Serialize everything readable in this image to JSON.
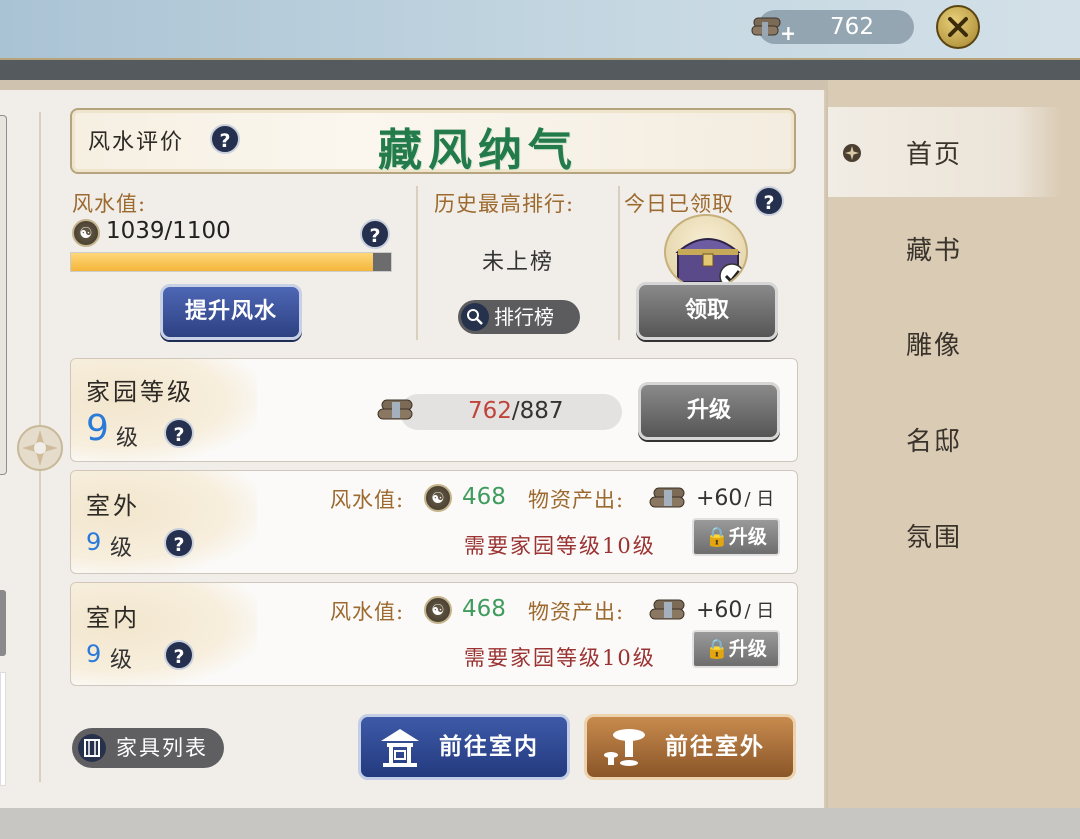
{
  "topbar": {
    "resource_value": "762"
  },
  "sidebar": {
    "items": [
      {
        "label": "首页",
        "active": true
      },
      {
        "label": "藏书",
        "active": false
      },
      {
        "label": "雕像",
        "active": false
      },
      {
        "label": "名邸",
        "active": false
      },
      {
        "label": "氛围",
        "active": false
      }
    ]
  },
  "rating": {
    "label": "风水评价",
    "title": "藏风纳气",
    "help": "?"
  },
  "fengshui": {
    "label": "风水值:",
    "value": "1039/1100",
    "progress": 0.945,
    "help": "?",
    "upgrade_button": "提升风水"
  },
  "ranking": {
    "label": "历史最高排行:",
    "value": "未上榜",
    "button": "排行榜"
  },
  "daily": {
    "label": "今日已领取",
    "help": "?",
    "button": "领取"
  },
  "home_level": {
    "title": "家园等级",
    "level_num": "9",
    "level_unit": "级",
    "help": "?",
    "progress_current": "762",
    "progress_sep": "/",
    "progress_max": "887",
    "upgrade_button": "升级"
  },
  "rooms": [
    {
      "title": "室外",
      "level_num": "9",
      "level_unit": "级",
      "help": "?",
      "fs_label": "风水值:",
      "fs_value": "468",
      "prod_label": "物资产出:",
      "prod_value": "+60",
      "prod_unit": "/ 日",
      "requirement": "需要家园等级10级",
      "upgrade_button": "升级"
    },
    {
      "title": "室内",
      "level_num": "9",
      "level_unit": "级",
      "help": "?",
      "fs_label": "风水值:",
      "fs_value": "468",
      "prod_label": "物资产出:",
      "prod_value": "+60",
      "prod_unit": "/ 日",
      "requirement": "需要家园等级10级",
      "upgrade_button": "升级"
    }
  ],
  "bottom": {
    "furniture_button": "家具列表",
    "goto_indoor": "前往室内",
    "goto_outdoor": "前往室外"
  },
  "colors": {
    "accent_green": "#237a4a",
    "level_blue": "#2a7ad8",
    "requirement_red": "#9a3232",
    "label_orange": "#9c6a2f",
    "button_blue": "#2d4182",
    "button_brown": "#8a5528"
  },
  "icons": [
    "resource-logs-icon",
    "close-icon",
    "coin-icon",
    "question-icon",
    "search-icon",
    "treasure-chest-icon",
    "book-icon",
    "pavilion-icon",
    "table-icon",
    "lock-icon"
  ]
}
